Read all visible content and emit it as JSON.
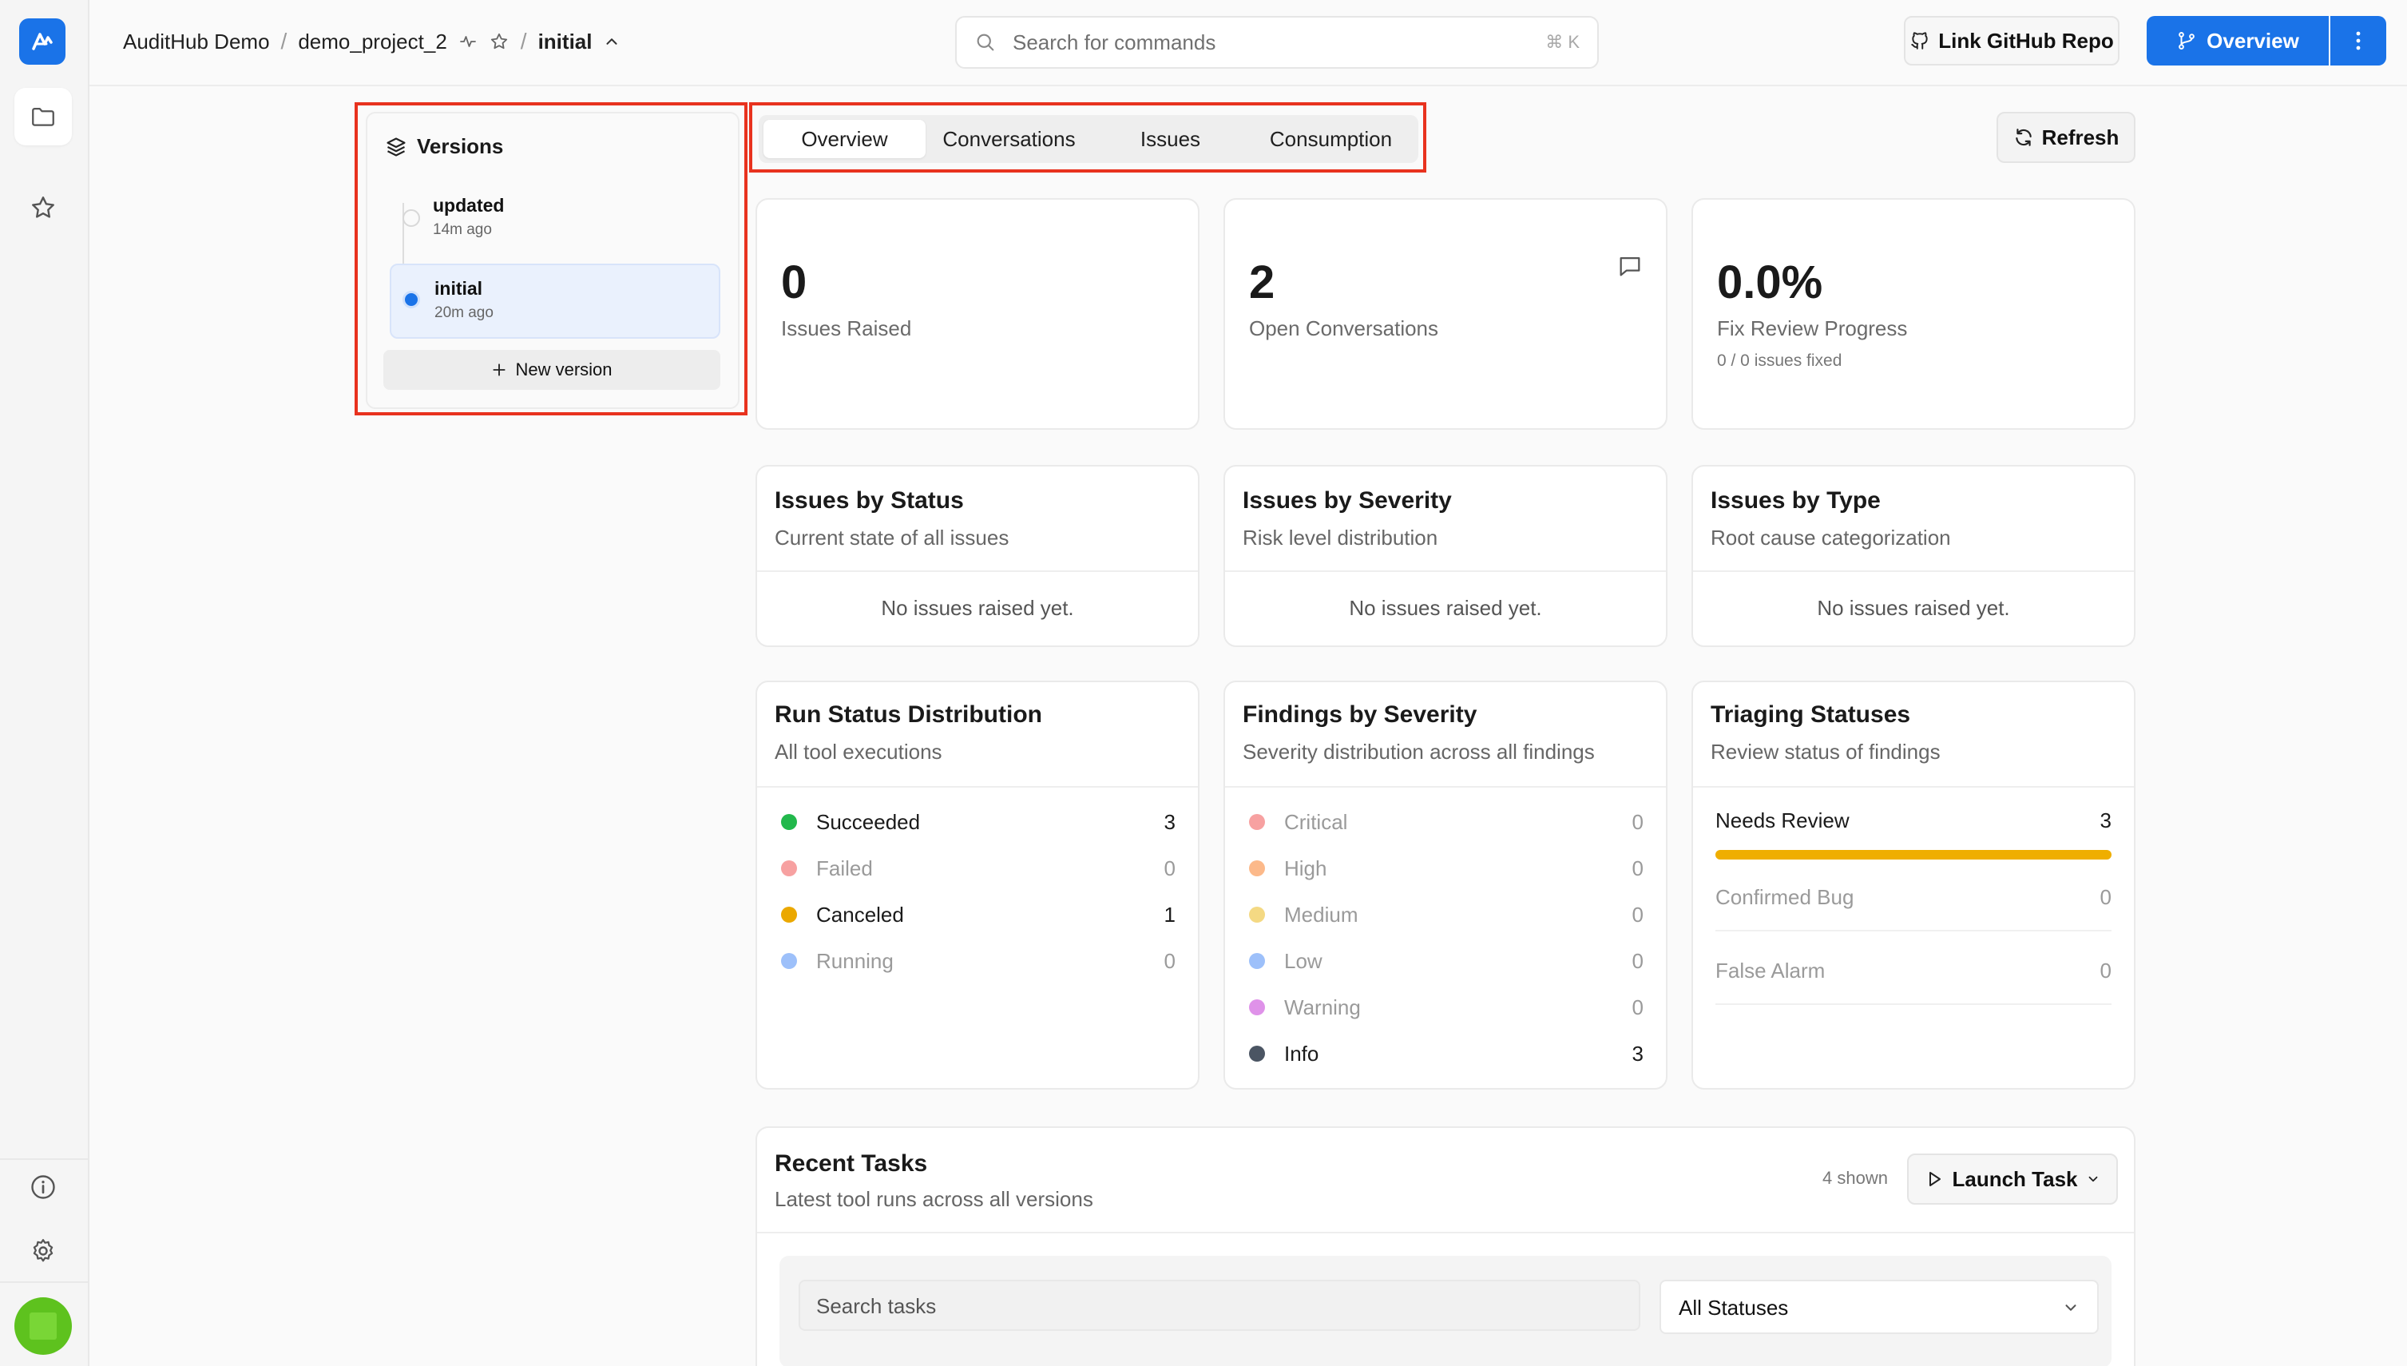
{
  "breadcrumb": {
    "org": "AuditHub Demo",
    "project": "demo_project_2",
    "separator": "/",
    "version": "initial"
  },
  "search": {
    "placeholder": "Search for commands",
    "shortcut": "⌘ K"
  },
  "header": {
    "link_github": "Link GitHub Repo",
    "overview": "Overview"
  },
  "versions": {
    "title": "Versions",
    "items": [
      {
        "name": "updated",
        "time": "14m ago"
      },
      {
        "name": "initial",
        "time": "20m ago"
      }
    ],
    "new_version": "New version"
  },
  "tabs": [
    "Overview",
    "Conversations",
    "Issues",
    "Consumption"
  ],
  "refresh": "Refresh",
  "stats": [
    {
      "value": "0",
      "label": "Issues Raised"
    },
    {
      "value": "2",
      "label": "Open Conversations"
    },
    {
      "value": "0.0%",
      "label": "Fix Review Progress",
      "sub": "0 / 0 issues fixed"
    }
  ],
  "issue_cards": [
    {
      "title": "Issues by Status",
      "subtitle": "Current state of all issues",
      "empty": "No issues raised yet."
    },
    {
      "title": "Issues by Severity",
      "subtitle": "Risk level distribution",
      "empty": "No issues raised yet."
    },
    {
      "title": "Issues by Type",
      "subtitle": "Root cause categorization",
      "empty": "No issues raised yet."
    }
  ],
  "run_status": {
    "title": "Run Status Distribution",
    "subtitle": "All tool executions",
    "rows": [
      {
        "label": "Succeeded",
        "value": "3",
        "color": "#22b84c"
      },
      {
        "label": "Failed",
        "value": "0",
        "color": "#ef4444"
      },
      {
        "label": "Canceled",
        "value": "1",
        "color": "#eba800"
      },
      {
        "label": "Running",
        "value": "0",
        "color": "#3b82f6"
      }
    ]
  },
  "findings": {
    "title": "Findings by Severity",
    "subtitle": "Severity distribution across all findings",
    "rows": [
      {
        "label": "Critical",
        "value": "0",
        "color": "#ef4444"
      },
      {
        "label": "High",
        "value": "0",
        "color": "#f97316"
      },
      {
        "label": "Medium",
        "value": "0",
        "color": "#eab308"
      },
      {
        "label": "Low",
        "value": "0",
        "color": "#3b82f6"
      },
      {
        "label": "Warning",
        "value": "0",
        "color": "#c026d3"
      },
      {
        "label": "Info",
        "value": "3",
        "color": "#4b5563"
      }
    ]
  },
  "triaging": {
    "title": "Triaging Statuses",
    "subtitle": "Review status of findings",
    "rows": [
      {
        "label": "Needs Review",
        "value": "3",
        "fill": 1.0,
        "color": "#efae00"
      },
      {
        "label": "Confirmed Bug",
        "value": "0"
      },
      {
        "label": "False Alarm",
        "value": "0"
      }
    ]
  },
  "recent_tasks": {
    "title": "Recent Tasks",
    "subtitle": "Latest tool runs across all versions",
    "shown": "4 shown",
    "launch": "Launch Task",
    "search_placeholder": "Search tasks",
    "status_filter": "All Statuses"
  },
  "colors": {
    "accent": "#1a73e8",
    "highlight": "#e8321e",
    "avatar": "#5ec21e"
  }
}
